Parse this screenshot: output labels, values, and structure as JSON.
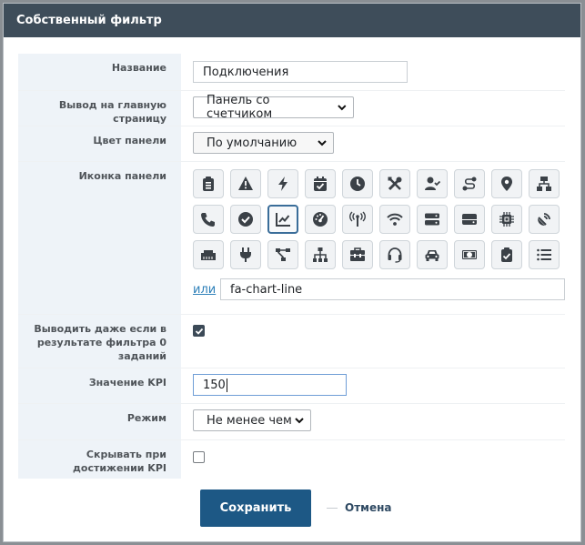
{
  "dialog": {
    "title": "Собственный фильтр",
    "fields": {
      "name": {
        "label": "Название",
        "value": "Подключения"
      },
      "output": {
        "label": "Вывод на главную страницу",
        "value": "Панель со счетчиком"
      },
      "color": {
        "label": "Цвет панели",
        "value": "По умолчанию"
      },
      "icon": {
        "label": "Иконка панели",
        "selected": "chart-line-icon",
        "or_label": "или",
        "custom_value": "fa-chart-line",
        "icons": [
          "clipboard-list-icon",
          "warning-icon",
          "bolt-icon",
          "calendar-check-icon",
          "clock-icon",
          "tools-icon",
          "user-check-icon",
          "route-icon",
          "map-marker-icon",
          "sitemap-network-icon",
          "phone-icon",
          "check-circle-icon",
          "chart-line-icon",
          "tachometer-icon",
          "broadcast-tower-icon",
          "wifi-icon",
          "server-icon",
          "hdd-icon",
          "microchip-icon",
          "satellite-dish-icon",
          "ethernet-icon",
          "plug-icon",
          "project-diagram-icon",
          "sitemap-icon",
          "toolbox-icon",
          "headset-icon",
          "car-icon",
          "money-bill-icon",
          "clipboard-check-icon",
          "list-icon"
        ]
      },
      "show_zero": {
        "label": "Выводить даже если в результате фильтра 0 заданий",
        "checked": true
      },
      "kpi": {
        "label": "Значение KPI",
        "value": "150"
      },
      "mode": {
        "label": "Режим",
        "value": "Не менее чем"
      },
      "hide_kpi": {
        "label": "Скрывать при достижении KPI",
        "checked": false
      }
    },
    "buttons": {
      "save": "Сохранить",
      "cancel": "Отмена"
    }
  }
}
